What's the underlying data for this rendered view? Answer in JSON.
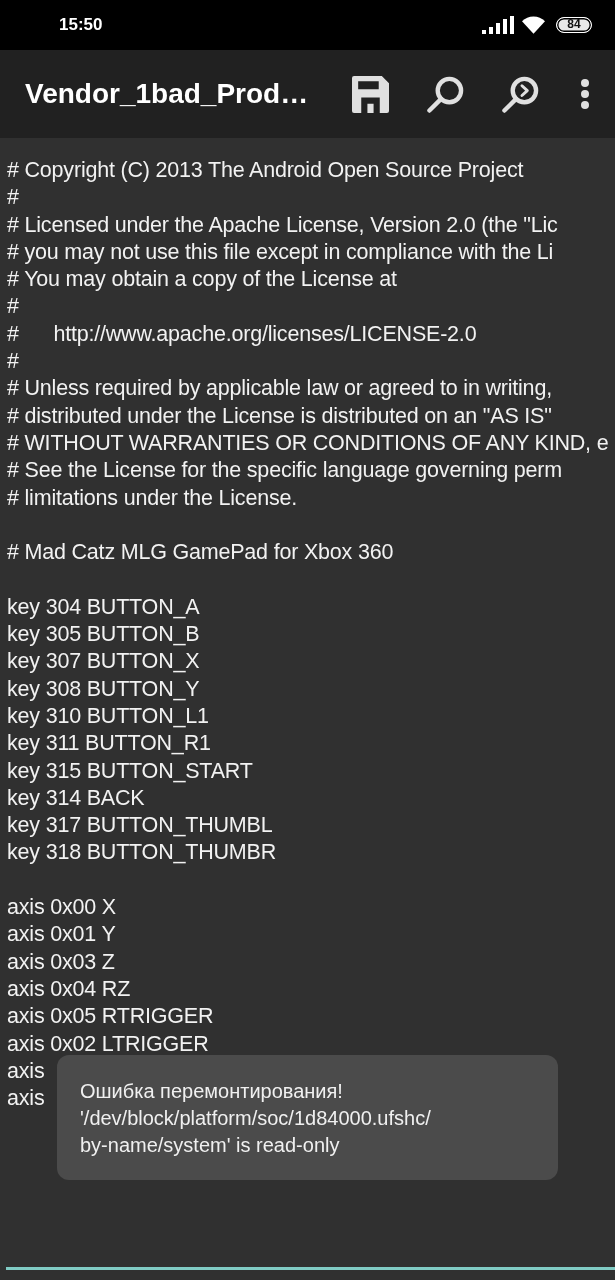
{
  "status_bar": {
    "time": "15:50",
    "battery": "84"
  },
  "toolbar": {
    "title": "Vendor_1bad_Prod…"
  },
  "editor": {
    "blocks": [
      [
        "# Copyright (C) 2013 The Android Open Source Project",
        "#",
        "# Licensed under the Apache License, Version 2.0 (the \"Lic",
        "# you may not use this file except in compliance with the Li",
        "# You may obtain a copy of the License at",
        "#",
        "#      http://www.apache.org/licenses/LICENSE-2.0",
        "#",
        "# Unless required by applicable law or agreed to in writing,",
        "# distributed under the License is distributed on an \"AS IS\"",
        "# WITHOUT WARRANTIES OR CONDITIONS OF ANY KIND, e",
        "# See the License for the specific language governing perm",
        "# limitations under the License."
      ],
      [
        "# Mad Catz MLG GamePad for Xbox 360"
      ],
      [
        "key 304 BUTTON_A",
        "key 305 BUTTON_B",
        "key 307 BUTTON_X",
        "key 308 BUTTON_Y",
        "key 310 BUTTON_L1",
        "key 311 BUTTON_R1",
        "key 315 BUTTON_START",
        "key 314 BACK",
        "key 317 BUTTON_THUMBL",
        "key 318 BUTTON_THUMBR"
      ],
      [
        "axis 0x00 X",
        "axis 0x01 Y",
        "axis 0x03 Z",
        "axis 0x04 RZ",
        "axis 0x05 RTRIGGER",
        "axis 0x02 LTRIGGER",
        "axis",
        "axis"
      ]
    ]
  },
  "toast": {
    "message": "Ошибка перемонтирования!\n'/dev/block/platform/soc/1d84000.ufshc/\nby-name/system' is read-only"
  }
}
